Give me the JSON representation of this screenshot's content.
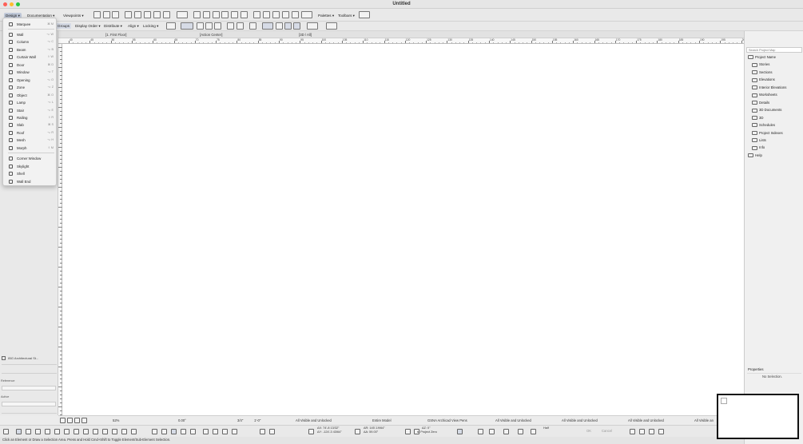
{
  "window": {
    "title": "Untitled",
    "traffic_colors": [
      "#ff5f57",
      "#febc2e",
      "#28c840"
    ]
  },
  "menubar": {
    "design": "Design",
    "documentation": "Documentation",
    "viewpoints": "Viewpoints",
    "palettes": "Palettes",
    "toolbars": "Toolbars"
  },
  "toolbar2": {
    "groups": "Groups",
    "display_order": "Display Order",
    "distribute": "Distribute",
    "align": "Align",
    "locking": "Locking"
  },
  "tabs": [
    {
      "label": "[1. First Floor]"
    },
    {
      "label": "[Action Center]"
    },
    {
      "label": "[3D / All]"
    }
  ],
  "ruler_ticks": [
    "40",
    "45",
    "50",
    "55",
    "60",
    "65",
    "70",
    "75",
    "80",
    "85",
    "90",
    "95",
    "100",
    "105",
    "110",
    "115",
    "120",
    "125",
    "130",
    "135",
    "140",
    "145",
    "150",
    "155",
    "160",
    "165",
    "170",
    "175",
    "180",
    "185",
    "190",
    "195",
    "200"
  ],
  "design_menu": {
    "items": [
      {
        "label": "Marquee",
        "shortcut": "⌘ M",
        "icon": "marquee-icon"
      },
      {
        "label": "Wall",
        "shortcut": "⌥ W",
        "icon": "wall-icon"
      },
      {
        "label": "Column",
        "shortcut": "⌥ C",
        "icon": "column-icon"
      },
      {
        "label": "Beam",
        "shortcut": "⌥ B",
        "icon": "beam-icon"
      },
      {
        "label": "Curtain Wall",
        "shortcut": "⇧ W",
        "icon": "curtain-wall-icon"
      },
      {
        "label": "Door",
        "shortcut": "⌘ D",
        "icon": "door-icon"
      },
      {
        "label": "Window",
        "shortcut": "⌥ T",
        "icon": "window-icon"
      },
      {
        "label": "Opening",
        "shortcut": "⌥ O",
        "icon": "opening-icon"
      },
      {
        "label": "Zone",
        "shortcut": "⌥ Z",
        "icon": "zone-icon"
      },
      {
        "label": "Object",
        "shortcut": "⌘ O",
        "icon": "object-icon"
      },
      {
        "label": "Lamp",
        "shortcut": "⌥ L",
        "icon": "lamp-icon"
      },
      {
        "label": "Stair",
        "shortcut": "⌥ E",
        "icon": "stair-icon"
      },
      {
        "label": "Railing",
        "shortcut": "⇧ R",
        "icon": "railing-icon"
      },
      {
        "label": "Slab",
        "shortcut": "⌘ S",
        "icon": "slab-icon"
      },
      {
        "label": "Roof",
        "shortcut": "⌥ R",
        "icon": "roof-icon"
      },
      {
        "label": "Mesh",
        "shortcut": "⌥ H",
        "icon": "mesh-icon"
      },
      {
        "label": "Morph",
        "shortcut": "⇧ M",
        "icon": "morph-icon"
      }
    ],
    "extras": [
      {
        "label": "Corner Window",
        "icon": "corner-window-icon"
      },
      {
        "label": "Skylight",
        "icon": "skylight-icon"
      },
      {
        "label": "Shell",
        "icon": "shell-icon"
      },
      {
        "label": "Wall End",
        "icon": "wall-end-icon"
      }
    ]
  },
  "left_panel": {
    "palette_title": "IBG Architectural St...",
    "reference": "Reference",
    "active": "Active"
  },
  "project_tree": [
    {
      "label": "Project Name",
      "level": 0
    },
    {
      "label": "Stories",
      "level": 1
    },
    {
      "label": "Sections",
      "level": 1
    },
    {
      "label": "Elevations",
      "level": 1
    },
    {
      "label": "Interior Elevations",
      "level": 1
    },
    {
      "label": "Worksheets",
      "level": 1
    },
    {
      "label": "Details",
      "level": 1
    },
    {
      "label": "3D Documents",
      "level": 1
    },
    {
      "label": "3D",
      "level": 1
    },
    {
      "label": "Schedules",
      "level": 1
    },
    {
      "label": "Project Indexes",
      "level": 1
    },
    {
      "label": "Lists",
      "level": 1
    },
    {
      "label": "Info",
      "level": 1
    },
    {
      "label": "Help",
      "level": 0
    }
  ],
  "right_panel": {
    "search_placeholder": "Search Project Map",
    "properties": "Properties",
    "no_selection": "No Selection."
  },
  "statusbar": {
    "zoom": "52%",
    "angle": "0.00°",
    "scale": "3/4\"",
    "dimension": "1'-0\"",
    "layer_all": "All Visible and Unlocked",
    "model_view": "Entire Model",
    "pens": "GSNA Archicad View Pens",
    "layer_2": "All Visible and Unlocked",
    "layer_3": "All Visible and Unlocked",
    "layer_4": "All Visible and Unlocked",
    "layer_5": "All Visible an"
  },
  "coords": {
    "dx": "ΔX: 74'-8 13/32\"",
    "dy": "ΔY: -124'-3 43/64\"",
    "dr": "ΔR: 145'-19/64\"",
    "da": "ΔA: 59.00°",
    "dz": "ΔZ: 0\"",
    "zero": "to Project Zero",
    "half": "Half",
    "ok": "OK",
    "cancel": "Cancel"
  },
  "hint": "Click an Element or Draw a Selection Area. Press and Hold Cmd+Shift to Toggle Element/Sub-Element Selection."
}
